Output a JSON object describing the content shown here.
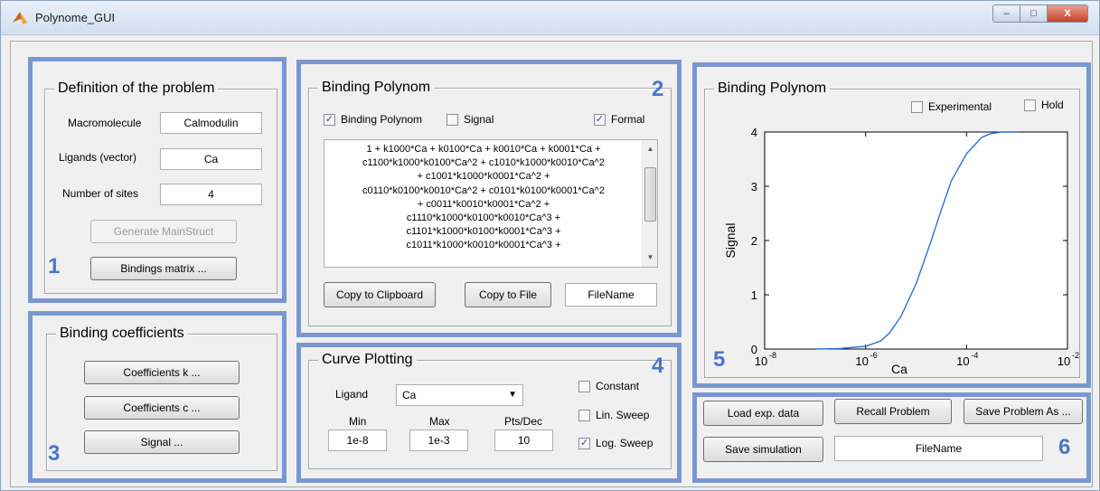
{
  "window": {
    "title": "Polynome_GUI",
    "minimize": "–",
    "maximize": "□",
    "close": "X"
  },
  "problem": {
    "title": "Definition of the problem",
    "macromolecule_label": "Macromolecule",
    "macromolecule_value": "Calmodulin",
    "ligands_label": "Ligands (vector)",
    "ligands_value": "Ca",
    "sites_label": "Number of sites",
    "sites_value": "4",
    "generate_button": "Generate MainStruct",
    "bindings_button": "Bindings matrix ...",
    "number": "1"
  },
  "polynom": {
    "title": "Binding Polynom",
    "number": "2",
    "check_polynom": "Binding Polynom",
    "check_signal": "Signal",
    "check_formal": "Formal",
    "lines": [
      "1 + k1000*Ca + k0100*Ca + k0010*Ca + k0001*Ca +",
      "c1100*k1000*k0100*Ca^2 + c1010*k1000*k0010*Ca^2",
      "+ c1001*k1000*k0001*Ca^2 +",
      "c0110*k0100*k0010*Ca^2 + c0101*k0100*k0001*Ca^2",
      "+ c0011*k0010*k0001*Ca^2 +",
      "c1110*k1000*k0100*k0010*Ca^3 +",
      "c1101*k1000*k0100*k0001*Ca^3 +",
      "c1011*k1000*k0010*k0001*Ca^3 +"
    ],
    "copy_clipboard": "Copy to Clipboard",
    "copy_file": "Copy to File",
    "filename": "FileName"
  },
  "coefficients": {
    "title": "Binding coefficients",
    "number": "3",
    "coef_k": "Coefficients k ...",
    "coef_c": "Coefficients c ...",
    "signal": "Signal ..."
  },
  "curve": {
    "title": "Curve Plotting",
    "number": "4",
    "ligand_label": "Ligand",
    "ligand_value": "Ca",
    "min_label": "Min",
    "max_label": "Max",
    "pts_label": "Pts/Dec",
    "min_value": "1e-8",
    "max_value": "1e-3",
    "pts_value": "10",
    "constant": "Constant",
    "lin_sweep": "Lin. Sweep",
    "log_sweep": "Log. Sweep"
  },
  "plot": {
    "title": "Binding Polynom",
    "number": "5",
    "experimental": "Experimental",
    "hold": "Hold"
  },
  "chart_data": {
    "type": "line",
    "xlabel": "Ca",
    "ylabel": "Signal",
    "xscale": "log",
    "xlim": [
      1e-08,
      0.01
    ],
    "ylim": [
      0,
      4
    ],
    "xticks": [
      "10",
      "10",
      "10",
      "10"
    ],
    "xtick_exponents": [
      "-8",
      "-6",
      "-4",
      "-2"
    ],
    "yticks": [
      "0",
      "1",
      "2",
      "3",
      "4"
    ],
    "series": [
      {
        "color": "#2e6fd6",
        "x": [
          1e-07,
          3e-07,
          1e-06,
          2e-06,
          3e-06,
          5e-06,
          1e-05,
          2e-05,
          3e-05,
          5e-05,
          0.0001,
          0.0002,
          0.0003,
          0.0005,
          0.001
        ],
        "y": [
          0.0,
          0.01,
          0.05,
          0.15,
          0.3,
          0.6,
          1.2,
          2.0,
          2.5,
          3.1,
          3.6,
          3.9,
          3.97,
          4.0,
          4.0
        ]
      }
    ]
  },
  "io": {
    "number": "6",
    "load": "Load exp. data",
    "recall": "Recall Problem",
    "save_as": "Save Problem As ...",
    "save_sim": "Save simulation",
    "filename": "FileName"
  },
  "colors": {
    "highlight": "#7a98cf",
    "number": "#4a76c6",
    "curve": "#2e6fd6"
  }
}
